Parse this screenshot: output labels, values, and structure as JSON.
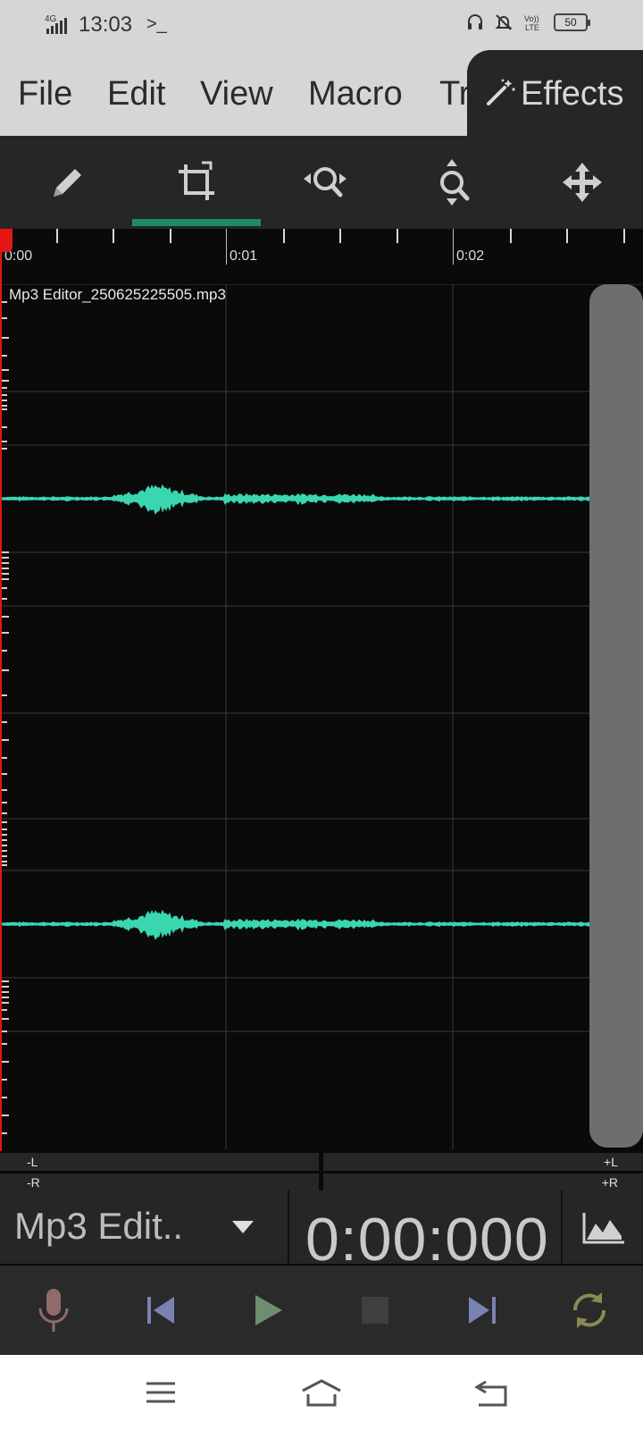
{
  "status_bar": {
    "network": "4G",
    "time": "13:03",
    "terminal_glyph": ">_",
    "volte": "Vo)) LTE",
    "battery": "50"
  },
  "menu": {
    "items": [
      "File",
      "Edit",
      "View",
      "Macro",
      "Tr"
    ],
    "effects_label": "Effects"
  },
  "toolbar": {
    "tools": [
      "pencil-icon",
      "crop-select-icon",
      "zoom-horizontal-icon",
      "zoom-vertical-icon",
      "move-icon"
    ],
    "active_tool_index": 1
  },
  "timeline": {
    "labels": [
      "0:00",
      "0:01",
      "0:02"
    ]
  },
  "track": {
    "file_name": "Mp3 Editor_250625225505.mp3",
    "wave_color": "#3ad6b0"
  },
  "meters": {
    "left_neg": "-L",
    "left_pos": "+L",
    "right_neg": "-R",
    "right_pos": "+R"
  },
  "controls": {
    "file_selector": "Mp3 Edit..",
    "timecode": "0:00:000"
  },
  "transport": {
    "buttons": [
      "microphone-icon",
      "skip-start-icon",
      "play-icon",
      "stop-icon",
      "skip-end-icon",
      "loop-icon"
    ]
  },
  "colors": {
    "accent": "#1e8a6c",
    "playhead": "#e31515",
    "waveform": "#3ad6b0"
  }
}
